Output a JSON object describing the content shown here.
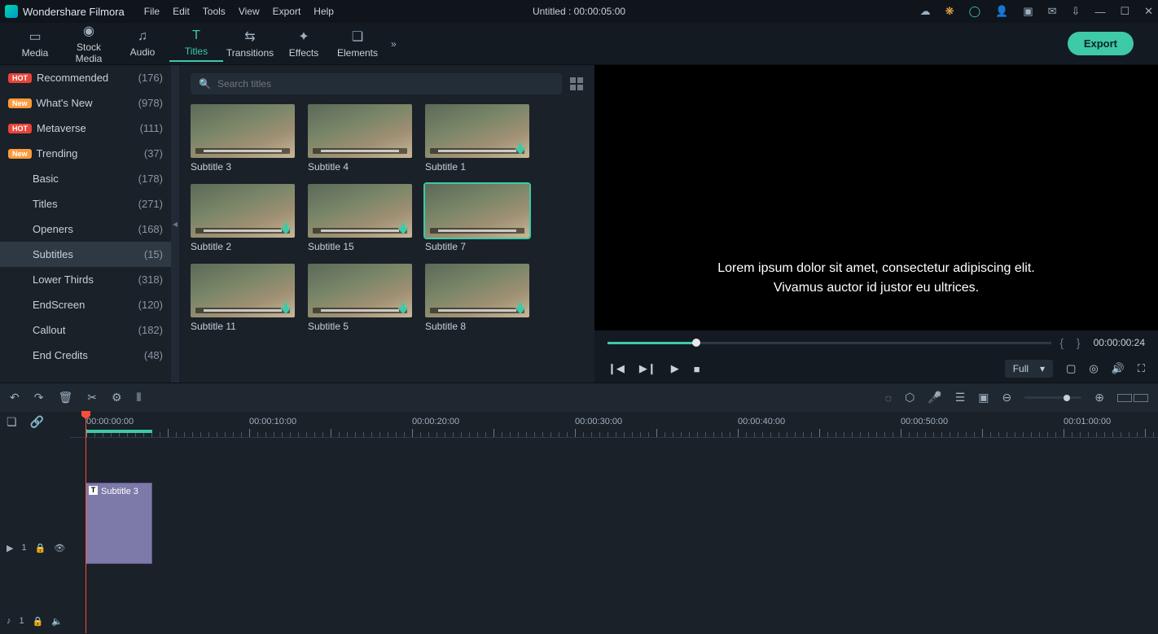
{
  "app": {
    "name": "Wondershare Filmora"
  },
  "menubar": [
    "File",
    "Edit",
    "Tools",
    "View",
    "Export",
    "Help"
  ],
  "document": {
    "title": "Untitled : 00:00:05:00"
  },
  "tabs": {
    "items": [
      {
        "label": "Media",
        "icon": "folder"
      },
      {
        "label": "Stock Media",
        "icon": "camera"
      },
      {
        "label": "Audio",
        "icon": "music"
      },
      {
        "label": "Titles",
        "icon": "text",
        "active": true
      },
      {
        "label": "Transitions",
        "icon": "shuffle"
      },
      {
        "label": "Effects",
        "icon": "sparkle"
      },
      {
        "label": "Elements",
        "icon": "shapes"
      }
    ],
    "export_label": "Export"
  },
  "sidebar": {
    "items": [
      {
        "badge": "HOT",
        "name": "Recommended",
        "count": "(176)"
      },
      {
        "badge": "New",
        "name": "What's New",
        "count": "(978)"
      },
      {
        "badge": "HOT",
        "name": "Metaverse",
        "count": "(111)"
      },
      {
        "badge": "New",
        "name": "Trending",
        "count": "(37)"
      },
      {
        "badge": "",
        "name": "Basic",
        "count": "(178)"
      },
      {
        "badge": "",
        "name": "Titles",
        "count": "(271)"
      },
      {
        "badge": "",
        "name": "Openers",
        "count": "(168)"
      },
      {
        "badge": "",
        "name": "Subtitles",
        "count": "(15)",
        "active": true
      },
      {
        "badge": "",
        "name": "Lower Thirds",
        "count": "(318)"
      },
      {
        "badge": "",
        "name": "EndScreen",
        "count": "(120)"
      },
      {
        "badge": "",
        "name": "Callout",
        "count": "(182)"
      },
      {
        "badge": "",
        "name": "End Credits",
        "count": "(48)"
      }
    ]
  },
  "search": {
    "placeholder": "Search titles"
  },
  "thumbs": [
    {
      "label": "Subtitle 3",
      "dl": false
    },
    {
      "label": "Subtitle 4",
      "dl": false
    },
    {
      "label": "Subtitle 1",
      "dl": true
    },
    {
      "label": "Subtitle 2",
      "dl": true
    },
    {
      "label": "Subtitle 15",
      "dl": true
    },
    {
      "label": "Subtitle 7",
      "dl": false,
      "selected": true
    },
    {
      "label": "Subtitle 11",
      "dl": true
    },
    {
      "label": "Subtitle 5",
      "dl": true
    },
    {
      "label": "Subtitle 8",
      "dl": true
    }
  ],
  "preview": {
    "line1": "Lorem ipsum dolor sit amet, consectetur adipiscing elit.",
    "line2": "Vivamus auctor id justor eu ultrices.",
    "timecode": "00:00:00:24",
    "quality": "Full"
  },
  "ruler": {
    "labels": [
      "00:00:00:00",
      "00:00:10:00",
      "00:00:20:00",
      "00:00:30:00",
      "00:00:40:00",
      "00:00:50:00",
      "00:01:00:00"
    ]
  },
  "timeline": {
    "clip_label": "Subtitle 3",
    "video_track": "1",
    "audio_track": "1"
  }
}
